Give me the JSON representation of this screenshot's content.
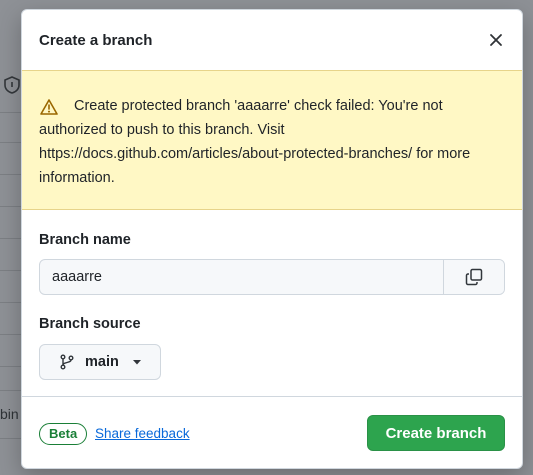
{
  "dialog": {
    "title": "Create a branch",
    "close_icon": "close-icon"
  },
  "warning": {
    "icon": "alert-triangle-icon",
    "message": "Create protected branch 'aaaarre' check failed: You're not authorized to push to this branch. Visit https://docs.github.com/articles/about-protected-branches/ for more information."
  },
  "branch_name": {
    "label": "Branch name",
    "value": "aaaarre",
    "copy_icon": "copy-icon"
  },
  "branch_source": {
    "label": "Branch source",
    "selected": "main",
    "icon": "git-branch-icon"
  },
  "footer": {
    "badge": "Beta",
    "feedback_link": "Share feedback",
    "create_button": "Create branch"
  },
  "background": {
    "partial_text": "bin"
  },
  "colors": {
    "warning_bg": "#fff8c5",
    "primary_button": "#2da44e",
    "link": "#0969da",
    "beta_green": "#1a7f37"
  }
}
